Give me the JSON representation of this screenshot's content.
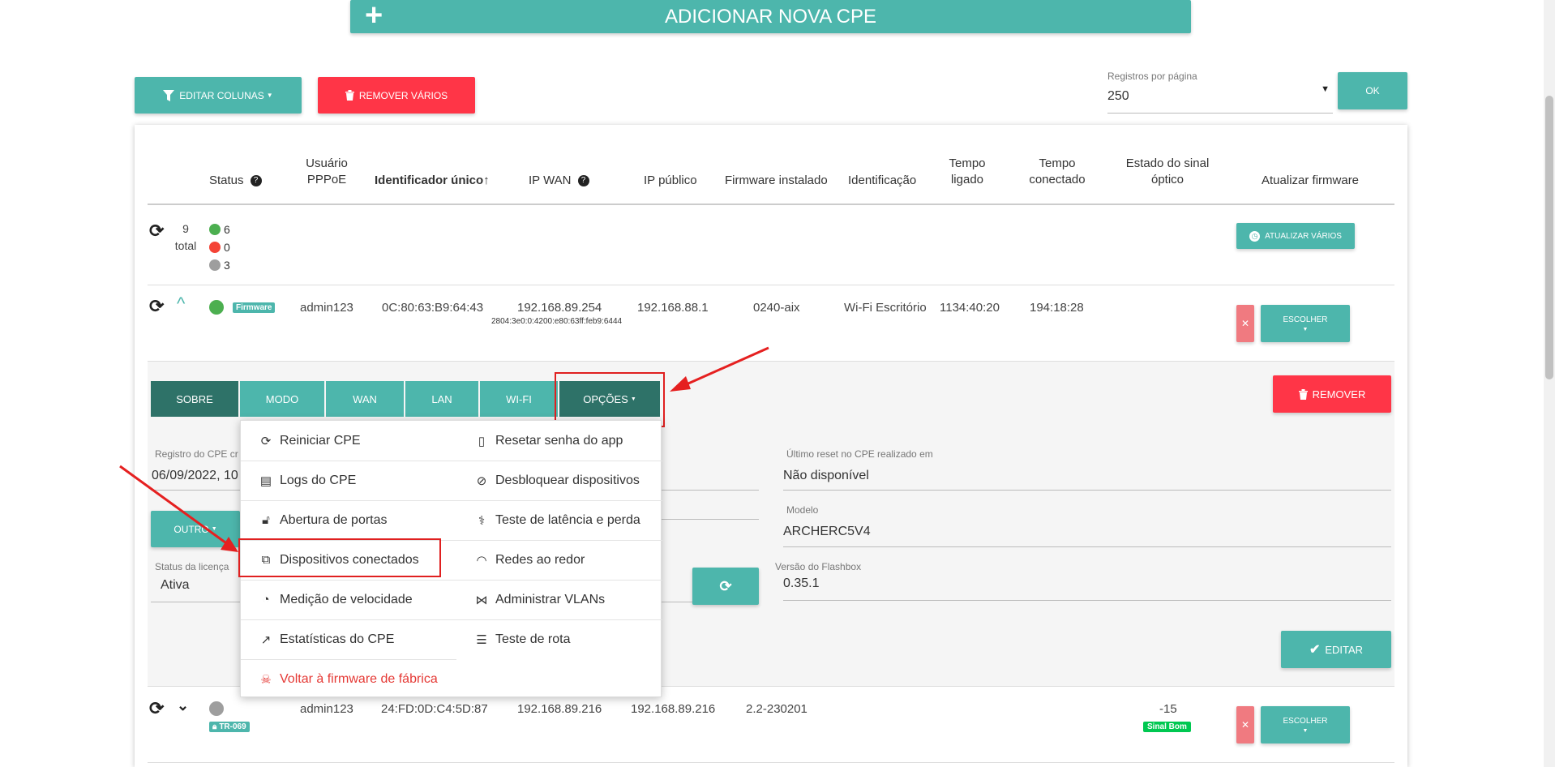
{
  "top_button": {
    "label": "Adicionar nova CPE"
  },
  "toolbar": {
    "edit_columns": "EDITAR COLUNAS",
    "remove_many": "REMOVER VÁRIOS",
    "per_page_label": "Registros por página",
    "per_page_value": "250",
    "ok": "OK"
  },
  "table": {
    "headers": {
      "status": "Status",
      "user_1": "Usuário",
      "user_2": "PPPoE",
      "uid": "Identificador único↑",
      "ip_wan": "IP WAN",
      "ip_public": "IP público",
      "firmware": "Firmware instalado",
      "ident": "Identificação",
      "uptime_1": "Tempo",
      "uptime_2": "ligado",
      "conn_1": "Tempo",
      "conn_2": "conectado",
      "signal_1": "Estado do sinal",
      "signal_2": "óptico",
      "update_fw": "Atualizar firmware"
    },
    "summary": {
      "total_num": "9",
      "total_label": "total",
      "green": "6",
      "red": "0",
      "grey": "3",
      "update_many": "ATUALIZAR VÁRIOS"
    },
    "row1": {
      "tag": "Firmware",
      "user": "admin123",
      "uid": "0C:80:63:B9:64:43",
      "ip_wan": "192.168.89.254",
      "ip_wan6": "2804:3e0:0:4200:e80:63ff:feb9:6444",
      "ip_public": "192.168.88.1",
      "firmware": "0240-aix",
      "ident": "Wi-Fi Escritório",
      "uptime": "1134:40:20",
      "conn": "194:18:28",
      "choose": "ESCOLHER"
    },
    "row2": {
      "tag": "TR-069",
      "user": "admin123",
      "uid": "24:FD:0D:C4:5D:87",
      "ip_wan": "192.168.89.216",
      "ip_public": "192.168.89.216",
      "firmware": "2.2-230201",
      "signal": "-15",
      "signal_badge": "Sinal Bom",
      "choose": "ESCOLHER"
    }
  },
  "tabs": [
    "SOBRE",
    "MODO",
    "WAN",
    "LAN",
    "WI-FI",
    "OPÇÕES"
  ],
  "details": {
    "remove": "REMOVER",
    "reg_label": "Registro do CPE cr",
    "reg_value": "06/09/2022, 10",
    "last_reset_label": "Último reset no CPE realizado em",
    "last_reset_value": "Não disponível",
    "model_label": "Modelo",
    "model_value": "ARCHERC5V4",
    "other": "OUTRO",
    "license_label": "Status da licença",
    "license_value": "Ativa",
    "flashbox_label": "Versão do Flashbox",
    "flashbox_value": "0.35.1",
    "edit": "EDITAR"
  },
  "menu": {
    "left": [
      "Reiniciar CPE",
      "Logs do CPE",
      "Abertura de portas",
      "Dispositivos conectados",
      "Medição de velocidade",
      "Estatísticas do CPE",
      "Voltar à firmware de fábrica"
    ],
    "right": [
      "Resetar senha do app",
      "Desbloquear dispositivos",
      "Teste de latência e perda",
      "Redes ao redor",
      "Administrar VLANs",
      "Teste de rota"
    ]
  },
  "colors": {
    "teal": "#4db6ac",
    "teal_dark": "#2e7268",
    "red": "#ff3547",
    "green": "#4caf50"
  }
}
